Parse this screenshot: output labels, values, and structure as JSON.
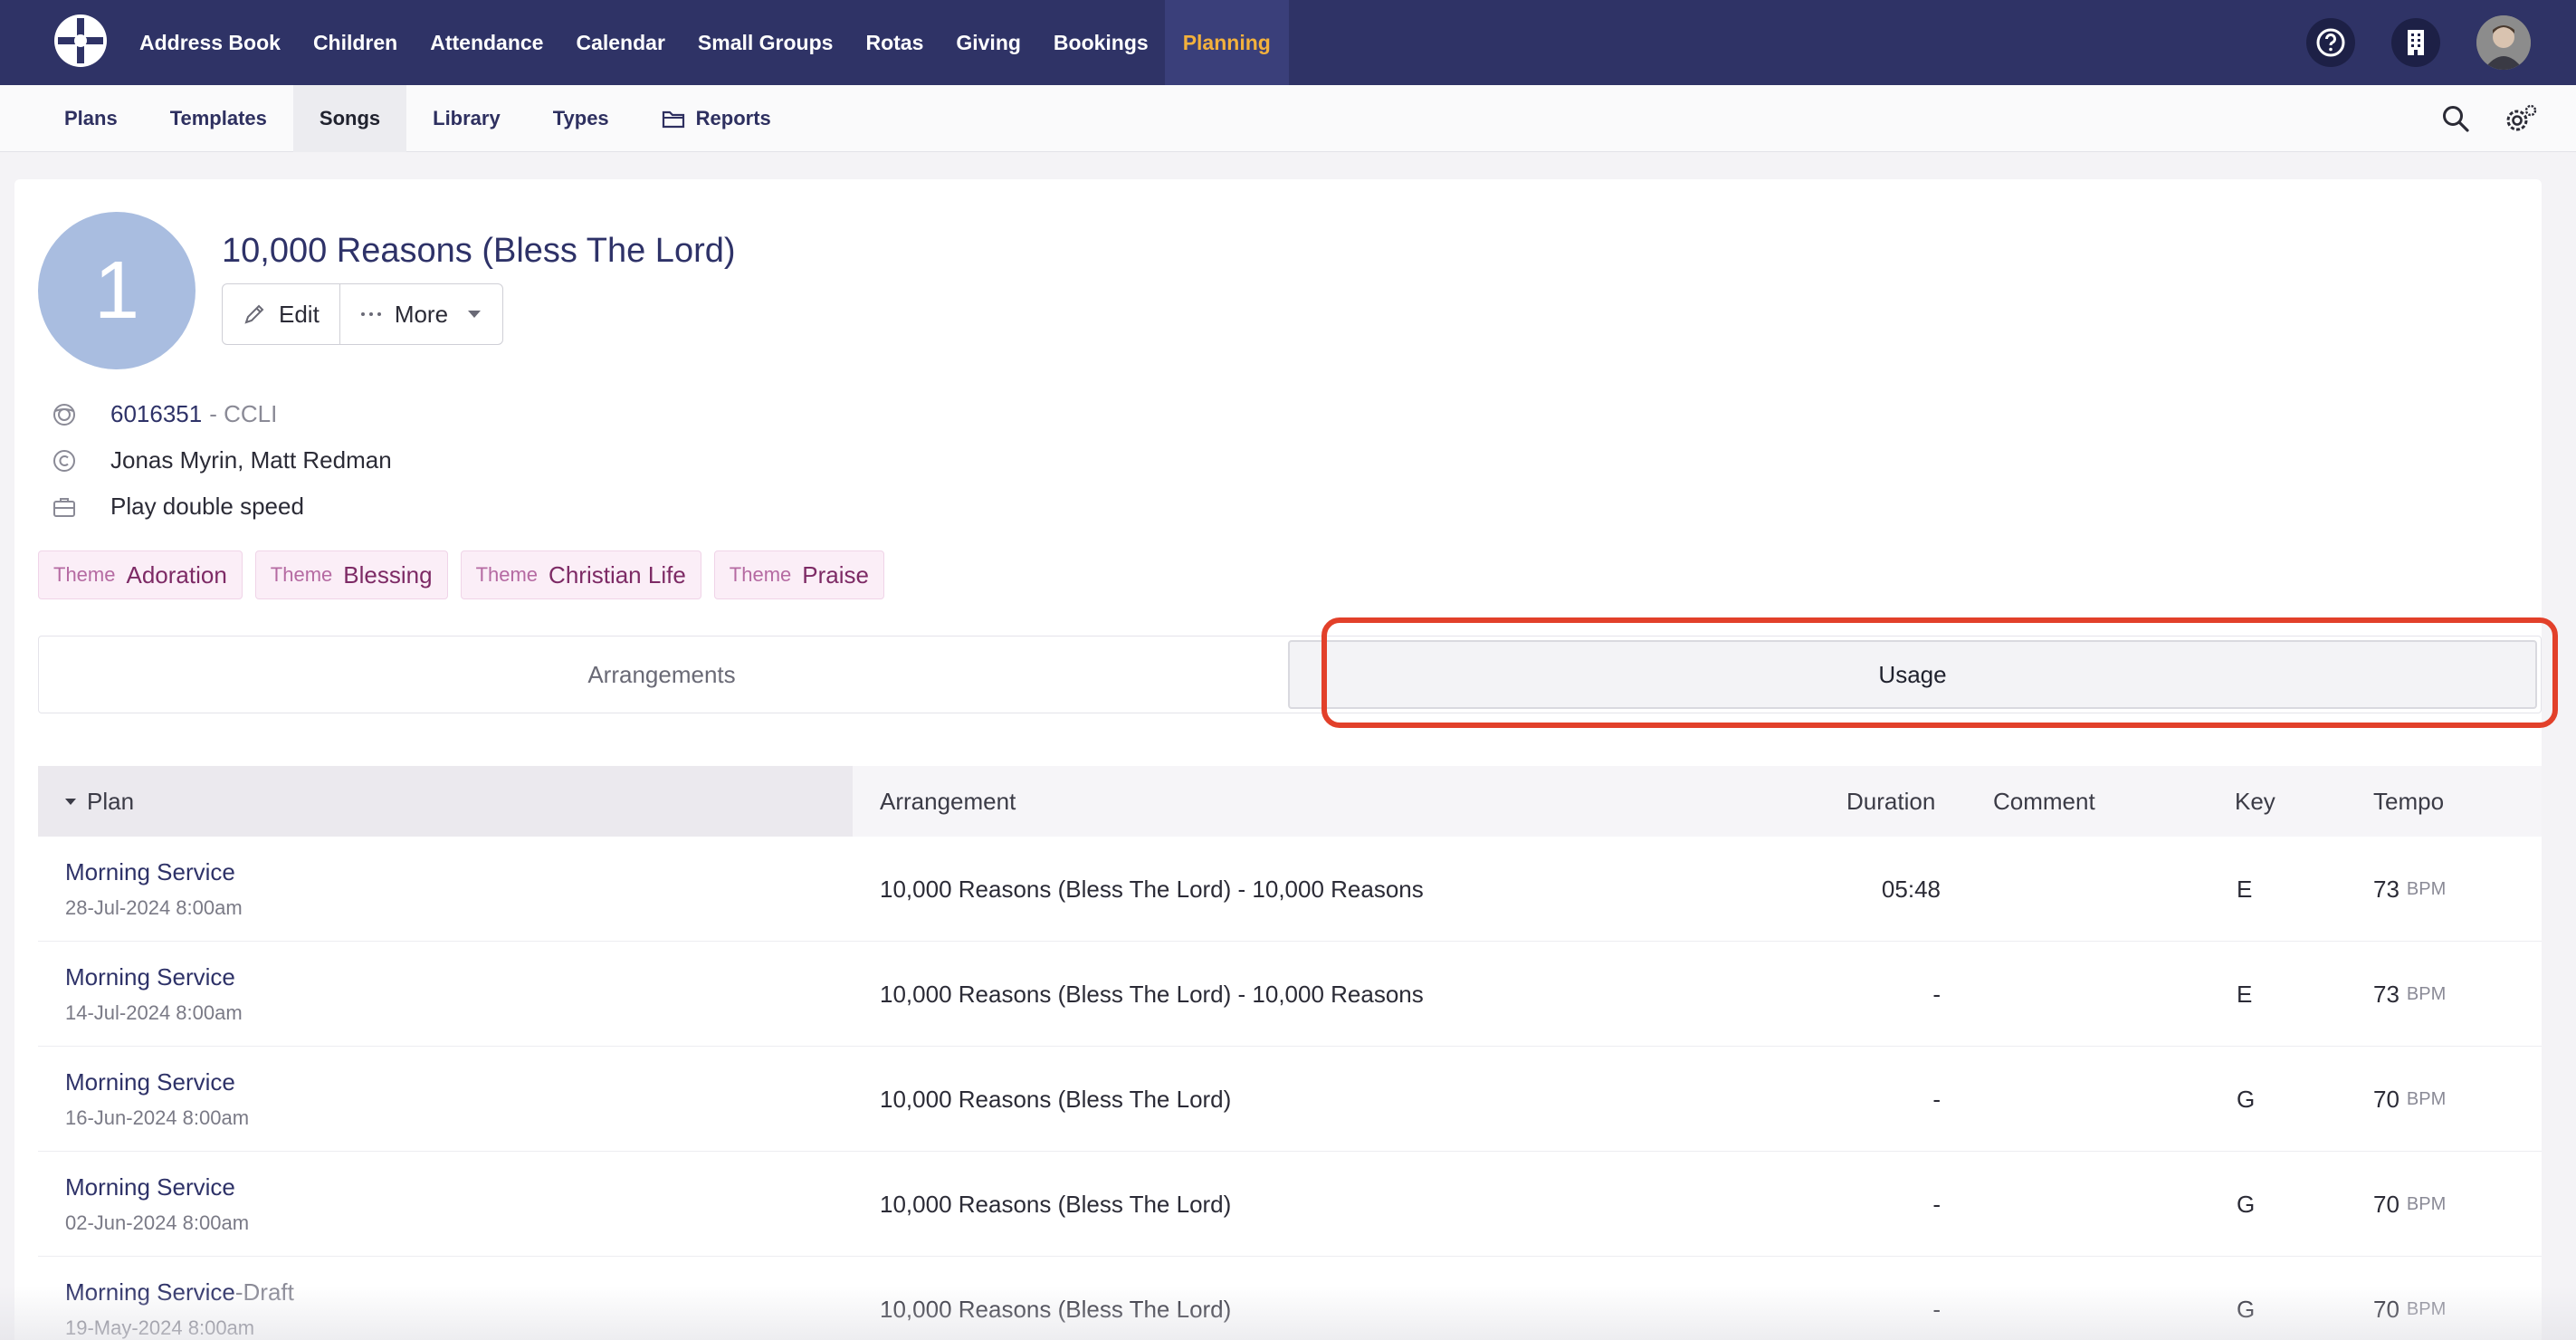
{
  "topnav": {
    "items": [
      {
        "label": "Address Book"
      },
      {
        "label": "Children"
      },
      {
        "label": "Attendance"
      },
      {
        "label": "Calendar"
      },
      {
        "label": "Small Groups"
      },
      {
        "label": "Rotas"
      },
      {
        "label": "Giving"
      },
      {
        "label": "Bookings"
      },
      {
        "label": "Planning",
        "active": true
      }
    ]
  },
  "subnav": {
    "items": [
      {
        "label": "Plans"
      },
      {
        "label": "Templates"
      },
      {
        "label": "Songs",
        "active": true
      },
      {
        "label": "Library"
      },
      {
        "label": "Types"
      },
      {
        "label": "Reports",
        "icon": "folder-icon"
      }
    ]
  },
  "song": {
    "avatar_text": "1",
    "title": "10,000 Reasons (Bless The Lord)",
    "edit_label": "Edit",
    "more_label": "More",
    "ccli_number": "6016351",
    "ccli_suffix": "- CCLI",
    "authors": "Jonas Myrin, Matt Redman",
    "note": "Play double speed",
    "tags": [
      {
        "label": "Theme",
        "value": "Adoration"
      },
      {
        "label": "Theme",
        "value": "Blessing"
      },
      {
        "label": "Theme",
        "value": "Christian Life"
      },
      {
        "label": "Theme",
        "value": "Praise"
      }
    ]
  },
  "tabs": {
    "arrangements": "Arrangements",
    "usage": "Usage"
  },
  "table": {
    "headers": {
      "plan": "Plan",
      "arrangement": "Arrangement",
      "duration": "Duration",
      "comment": "Comment",
      "key": "Key",
      "tempo": "Tempo"
    },
    "bpm_unit": "BPM",
    "rows": [
      {
        "plan": "Morning Service",
        "draft": "",
        "date": "28-Jul-2024 8:00am",
        "arrangement": "10,000 Reasons (Bless The Lord) - 10,000 Reasons",
        "duration": "05:48",
        "comment": "",
        "key": "E",
        "tempo": "73"
      },
      {
        "plan": "Morning Service",
        "draft": "",
        "date": "14-Jul-2024 8:00am",
        "arrangement": "10,000 Reasons (Bless The Lord) - 10,000 Reasons",
        "duration": "-",
        "comment": "",
        "key": "E",
        "tempo": "73"
      },
      {
        "plan": "Morning Service",
        "draft": "",
        "date": "16-Jun-2024 8:00am",
        "arrangement": "10,000 Reasons (Bless The Lord)",
        "duration": "-",
        "comment": "",
        "key": "G",
        "tempo": "70"
      },
      {
        "plan": "Morning Service",
        "draft": "",
        "date": "02-Jun-2024 8:00am",
        "arrangement": "10,000 Reasons (Bless The Lord)",
        "duration": "-",
        "comment": "",
        "key": "G",
        "tempo": "70"
      },
      {
        "plan": "Morning Service",
        "draft": "-Draft",
        "date": "19-May-2024 8:00am",
        "arrangement": "10,000 Reasons (Bless The Lord)",
        "duration": "-",
        "comment": "",
        "key": "G",
        "tempo": "70"
      }
    ]
  }
}
